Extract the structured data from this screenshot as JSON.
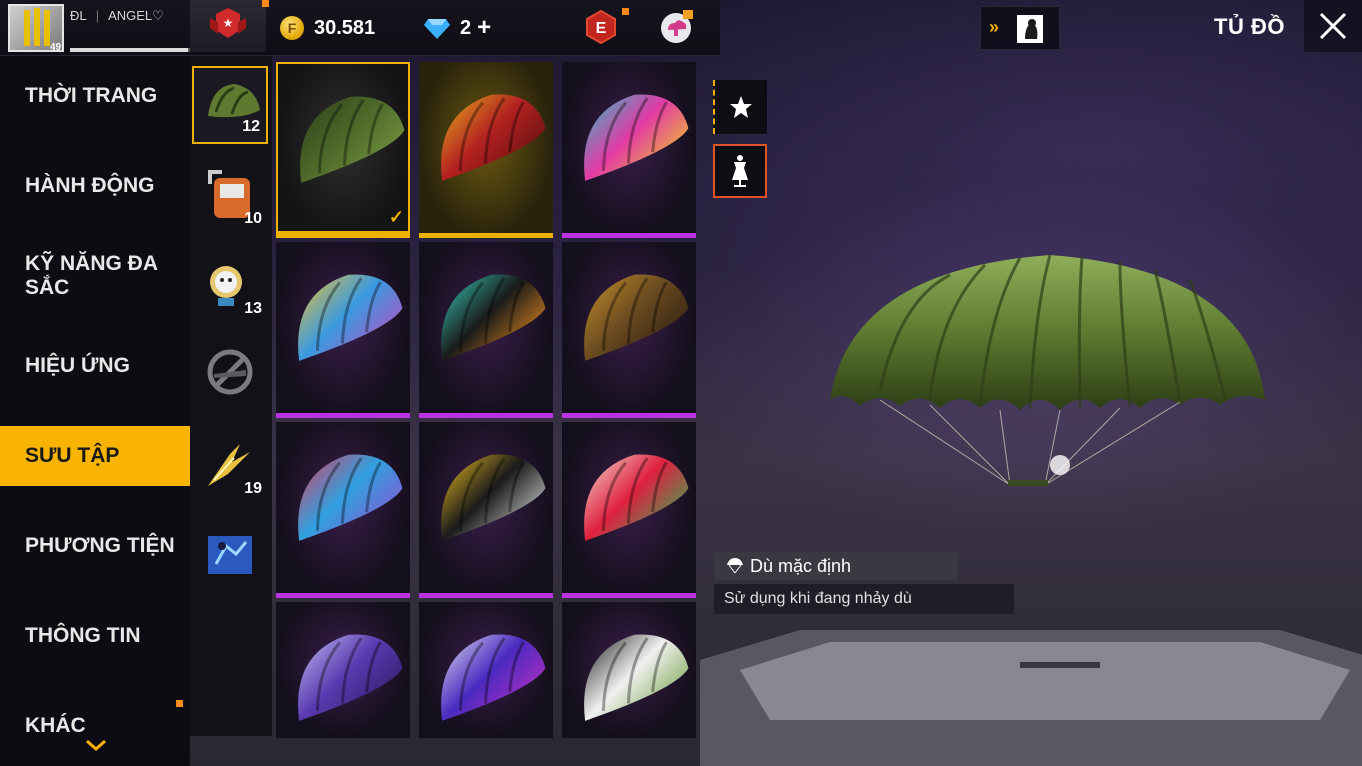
{
  "player": {
    "level": "49",
    "guild_tag": "ĐL",
    "name": "ANGEL♡",
    "xp_fraction": 0.98
  },
  "currency": {
    "gold": "30.581",
    "diamonds": "2",
    "diamonds_add": "+"
  },
  "header": {
    "title": "TỦ ĐỒ",
    "event_letter": "E"
  },
  "menu": {
    "items": [
      {
        "label": "THỜI TRANG"
      },
      {
        "label": "HÀNH ĐỘNG"
      },
      {
        "label": "KỸ NĂNG ĐA SẮC"
      },
      {
        "label": "HIỆU ỨNG"
      },
      {
        "label": "SƯU TẬP"
      },
      {
        "label": "PHƯƠNG TIỆN"
      },
      {
        "label": "THÔNG TIN"
      },
      {
        "label": "KHÁC"
      }
    ],
    "active_index": 4
  },
  "subcategories": [
    {
      "icon": "parachute-icon",
      "count": "12"
    },
    {
      "icon": "backpack-icon",
      "count": "10"
    },
    {
      "icon": "pet-icon",
      "count": "13"
    },
    {
      "icon": "no-skyboard-icon",
      "count": ""
    },
    {
      "icon": "skywing-icon",
      "count": "19"
    },
    {
      "icon": "banner-icon",
      "count": ""
    }
  ],
  "grid": {
    "items": [
      {
        "name": "camo-parachute",
        "rarity": "selected",
        "colors": [
          "#4d6a2a",
          "#2c3d18",
          "#7a9a40"
        ]
      },
      {
        "name": "phoenix-parachute",
        "rarity": "gold",
        "colors": [
          "#b32020",
          "#e6b020",
          "#5a1010"
        ]
      },
      {
        "name": "graffiti-parachute",
        "rarity": "epic",
        "colors": [
          "#e23aa6",
          "#28c0c0",
          "#f0d020"
        ]
      },
      {
        "name": "star-parachute",
        "rarity": "epic",
        "colors": [
          "#3a9ae0",
          "#f0c030",
          "#c04ac0"
        ]
      },
      {
        "name": "flame-parachute",
        "rarity": "epic",
        "colors": [
          "#1a1a1a",
          "#38d0c0",
          "#f09020"
        ]
      },
      {
        "name": "leo-parachute",
        "rarity": "epic",
        "colors": [
          "#6a4a20",
          "#c8922a",
          "#2a1c10"
        ]
      },
      {
        "name": "color-splash-parachute",
        "rarity": "epic",
        "colors": [
          "#30a0e0",
          "#e03a5a",
          "#9050d0"
        ]
      },
      {
        "name": "hex-parachute",
        "rarity": "epic",
        "colors": [
          "#1a1a1a",
          "#f0c020",
          "#dcdcdc"
        ]
      },
      {
        "name": "clown-parachute",
        "rarity": "epic",
        "colors": [
          "#e02040",
          "#f0e0d0",
          "#30b050"
        ]
      },
      {
        "name": "lightning-parachute",
        "rarity": "epic",
        "colors": [
          "#5a3ab0",
          "#c0c0f0",
          "#2a1a60"
        ]
      },
      {
        "name": "glitch-parachute",
        "rarity": "epic",
        "colors": [
          "#4a2ac0",
          "#e0e0f0",
          "#c030c0"
        ]
      },
      {
        "name": "soccer-parachute",
        "rarity": "rare",
        "colors": [
          "#f0f0f0",
          "#1a1a1a",
          "#70a040"
        ]
      }
    ]
  },
  "item_info": {
    "name": "Dù mặc định",
    "description": "Sử dụng khi đang nhảy dù"
  },
  "colors": {
    "accent": "#f8b400",
    "epic": "#b832e0",
    "notif": "#ff8a1c"
  }
}
